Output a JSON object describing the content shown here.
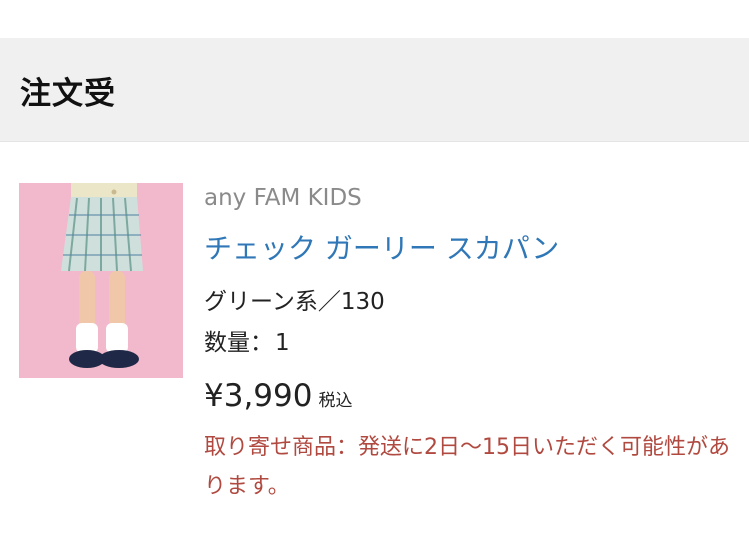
{
  "section": {
    "title": "注文受"
  },
  "item": {
    "brand": "any FAM KIDS",
    "name": "チェック ガーリー スカパン",
    "variant": "グリーン系／130",
    "quantity_label": "数量：",
    "quantity": "1",
    "price": "¥3,990",
    "tax_label": "税込",
    "notice": "取り寄せ商品：発送に2日〜15日いただく可能性があります。"
  },
  "colors": {
    "header_bg": "#f0f0f0",
    "link": "#2f77b6",
    "notice": "#b04a40",
    "brand": "#8a8a8a",
    "image_bg": "#f2b9cd"
  }
}
